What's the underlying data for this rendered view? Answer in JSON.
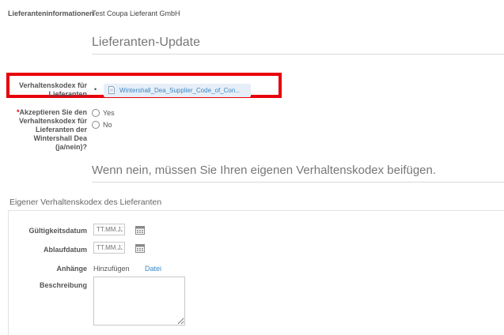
{
  "supplier_info": {
    "label": "Lieferanteninformationen",
    "value": "Test Coupa Lieferant GmbH"
  },
  "section1": {
    "title": "Lieferanten-Update"
  },
  "code_of_conduct": {
    "label": "Verhaltenskodex für Lieferanten",
    "bullet": "•",
    "file_name": "Wintershall_Dea_Supplier_Code_of_Con..."
  },
  "accept": {
    "required_marker": "*",
    "label": "Akzeptieren Sie den Verhaltenskodex für Lieferanten der Wintershall Dea (ja/nein)?",
    "options": [
      "Yes",
      "No"
    ]
  },
  "hint": {
    "text": "Wenn nein, müssen Sie Ihren eigenen Verhaltenskodex beifügen."
  },
  "own_code": {
    "title": "Eigener Verhaltenskodex des Lieferanten",
    "valid_from": {
      "label": "Gültigkeitsdatum",
      "placeholder": "TT.MM.JJ"
    },
    "expiry": {
      "label": "Ablaufdatum",
      "placeholder": "TT.MM.JJ"
    },
    "attachments": {
      "label": "Anhänge",
      "add": "Hinzufügen",
      "file_link": "Datei"
    },
    "description": {
      "label": "Beschreibung"
    }
  },
  "colors": {
    "highlight": "#e8000b",
    "link": "#3a87c7",
    "chip_bg": "#e6eef7"
  }
}
